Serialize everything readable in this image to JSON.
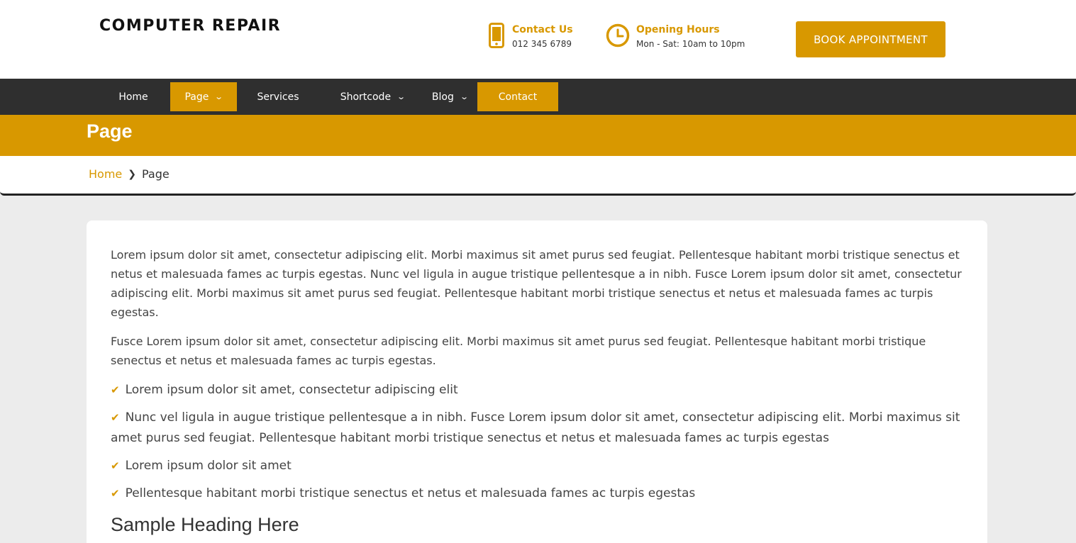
{
  "header": {
    "brand": "COMPUTER REPAIR",
    "contact": {
      "title": "Contact Us",
      "value": "012 345 6789",
      "icon": "phone-icon"
    },
    "hours": {
      "title": "Opening Hours",
      "value": "Mon - Sat: 10am to 10pm",
      "icon": "clock-icon"
    },
    "book_label": "BOOK APPOINTMENT"
  },
  "nav": {
    "items": [
      {
        "label": "Home",
        "has_dropdown": false,
        "active": false
      },
      {
        "label": "Page",
        "has_dropdown": true,
        "active": true
      },
      {
        "label": "Services",
        "has_dropdown": false,
        "active": false
      },
      {
        "label": "Shortcode",
        "has_dropdown": true,
        "active": false
      },
      {
        "label": "Blog",
        "has_dropdown": true,
        "active": false
      },
      {
        "label": "Contact",
        "has_dropdown": false,
        "active": true
      }
    ]
  },
  "banner": {
    "title": "Page"
  },
  "breadcrumb": {
    "home": "Home",
    "current": "Page"
  },
  "content": {
    "paragraphs": [
      "Lorem ipsum dolor sit amet, consectetur adipiscing elit. Morbi maximus sit amet purus sed feugiat. Pellentesque habitant morbi tristique senectus et netus et malesuada fames ac turpis egestas. Nunc vel ligula in augue tristique pellentesque a in nibh. Fusce Lorem ipsum dolor sit amet, consectetur adipiscing elit. Morbi maximus sit amet purus sed feugiat. Pellentesque habitant morbi tristique senectus et netus et malesuada fames ac turpis egestas.",
      "Fusce Lorem ipsum dolor sit amet, consectetur adipiscing elit. Morbi maximus sit amet purus sed feugiat. Pellentesque habitant morbi tristique senectus et netus et malesuada fames ac turpis egestas."
    ],
    "checklist": [
      "Lorem ipsum dolor sit amet, consectetur adipiscing elit",
      "Nunc vel ligula in augue tristique pellentesque a in nibh. Fusce Lorem ipsum dolor sit amet, consectetur adipiscing elit. Morbi maximus sit amet purus sed feugiat. Pellentesque habitant morbi tristique senectus et netus et malesuada fames ac turpis egestas",
      "Lorem ipsum dolor sit amet",
      "Pellentesque habitant morbi tristique senectus et netus et malesuada fames ac turpis egestas"
    ],
    "sample_heading": "Sample Heading Here"
  },
  "colors": {
    "accent": "#d89800",
    "nav_bg": "#2f2f2f",
    "page_bg": "#ececec"
  }
}
